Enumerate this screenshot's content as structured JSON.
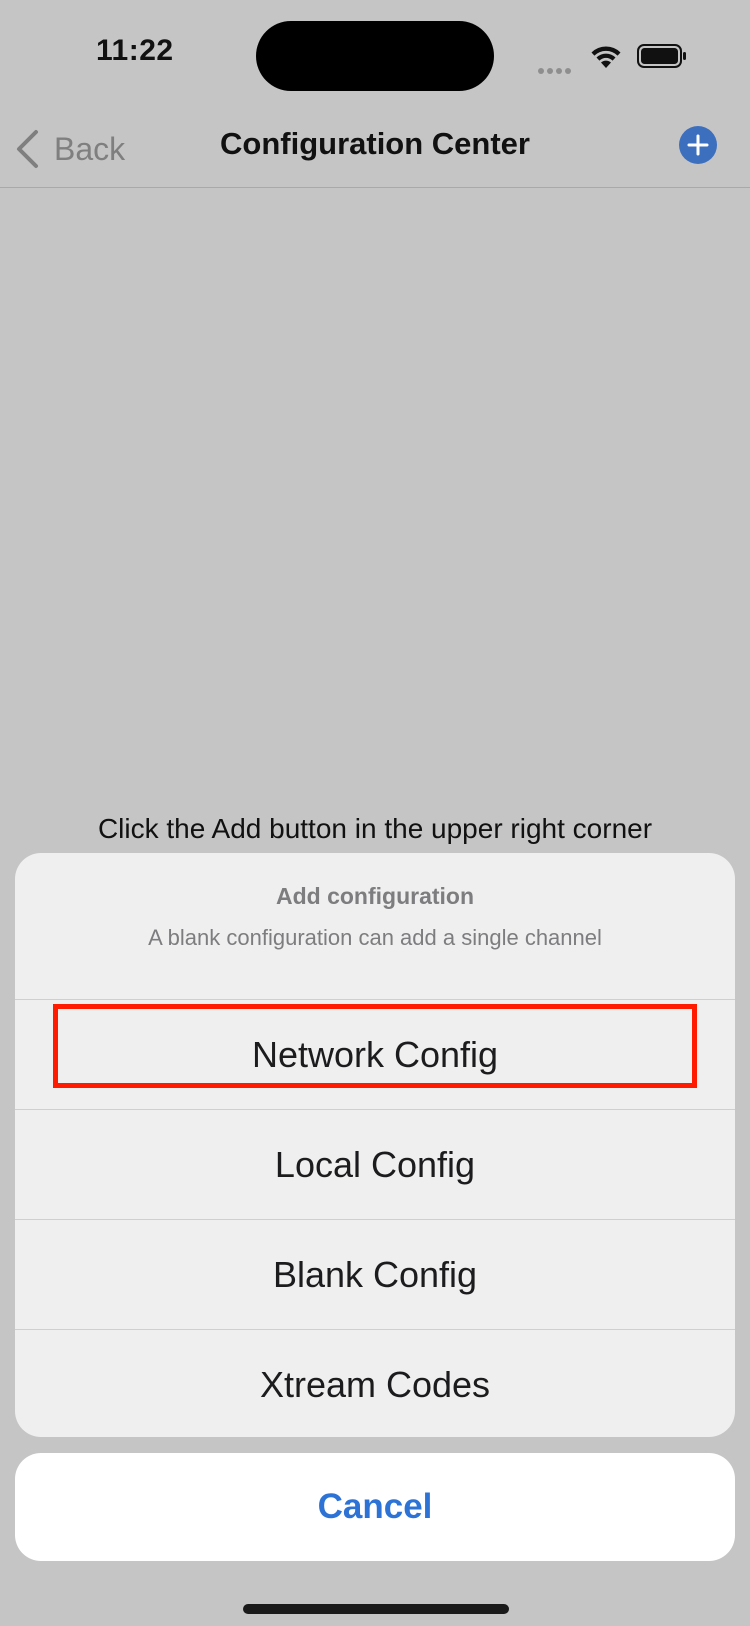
{
  "status_bar": {
    "time": "11:22"
  },
  "nav": {
    "back_label": "Back",
    "title": "Configuration Center",
    "add_icon": "plus-circle-icon",
    "accent_color": "#3d6fbf"
  },
  "empty_hint": "Click the Add button in the upper right corner",
  "action_sheet": {
    "title": "Add configuration",
    "message": "A blank configuration can add a single channel",
    "items": [
      {
        "label": "Network Config",
        "highlighted": true
      },
      {
        "label": "Local Config"
      },
      {
        "label": "Blank Config"
      },
      {
        "label": "Xtream Codes"
      }
    ],
    "cancel_label": "Cancel",
    "cancel_color": "#2d73d6",
    "highlight_color": "#ff1a00"
  }
}
